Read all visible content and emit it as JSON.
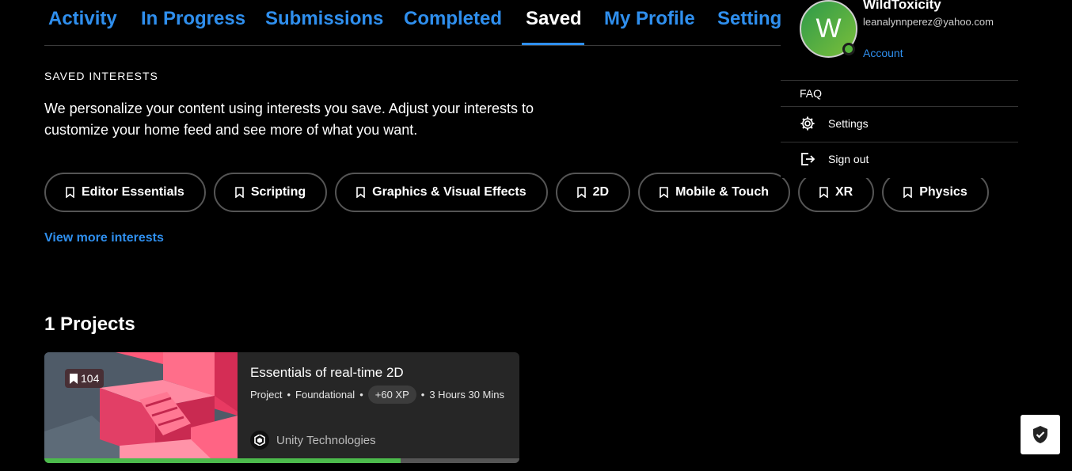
{
  "tabs": [
    {
      "label": "Activity"
    },
    {
      "label": "In Progress"
    },
    {
      "label": "Submissions"
    },
    {
      "label": "Completed"
    },
    {
      "label": "Saved"
    },
    {
      "label": "My Profile"
    },
    {
      "label": "Setting"
    }
  ],
  "active_tab": "Saved",
  "saved_interests": {
    "heading": "SAVED INTERESTS",
    "description": "We personalize your content using interests you save. Adjust your interests to customize your home feed and see more of what you want.",
    "chips": [
      {
        "label": "Editor Essentials",
        "icon": "bookmark-icon"
      },
      {
        "label": "Scripting",
        "icon": "bookmark-icon"
      },
      {
        "label": "Graphics & Visual Effects",
        "icon": "bookmark-icon"
      },
      {
        "label": "2D",
        "icon": "bookmark-icon"
      },
      {
        "label": "Mobile & Touch",
        "icon": "bookmark-icon"
      },
      {
        "label": "XR",
        "icon": "bookmark-icon"
      },
      {
        "label": "Physics",
        "icon": "bookmark-icon"
      }
    ],
    "view_more": "View more interests"
  },
  "projects": {
    "heading": "1 Projects",
    "items": [
      {
        "title": "Essentials of real-time 2D",
        "saves": "104",
        "type": "Project",
        "level": "Foundational",
        "xp": "+60 XP",
        "duration": "3 Hours 30 Mins",
        "author": "Unity Technologies",
        "progress_percent": 75
      }
    ]
  },
  "account_menu": {
    "avatar_initial": "W",
    "username": "WildToxicity",
    "email": "leanalynnperez@yahoo.com",
    "account_link": "Account",
    "items": [
      {
        "label": "FAQ",
        "icon": ""
      },
      {
        "label": "Settings",
        "icon": "gear-icon"
      },
      {
        "label": "Sign out",
        "icon": "sign-out-icon"
      }
    ]
  },
  "colors": {
    "accent": "#2f8fee",
    "background": "#000000",
    "progress": "#4cbb4c"
  }
}
